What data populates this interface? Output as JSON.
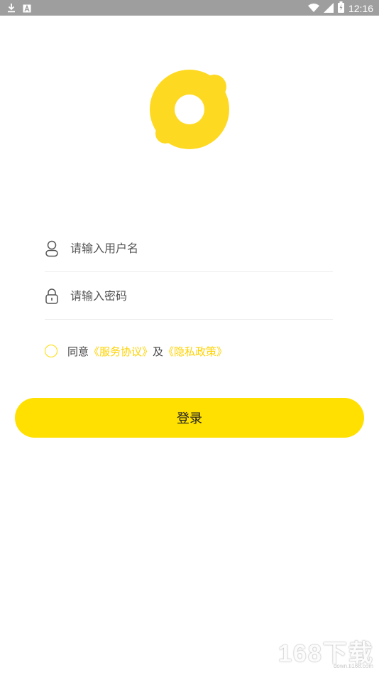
{
  "status_bar": {
    "time": "12:16",
    "icons": [
      "download-icon",
      "a-icon",
      "wifi-icon",
      "signal-icon",
      "battery-icon"
    ]
  },
  "colors": {
    "brand_yellow": "#ffe000",
    "link_yellow": "#ffd200",
    "status_bar": "#9e9e9e"
  },
  "login": {
    "username_placeholder": "请输入用户名",
    "password_placeholder": "请输入密码",
    "agree_prefix": "同意",
    "service_agreement": "《服务协议》",
    "conjunction": "及",
    "privacy_policy": "《隐私政策》",
    "login_button": "登录"
  },
  "watermark": {
    "main": "168下载",
    "sub": "down.ti168.com"
  }
}
